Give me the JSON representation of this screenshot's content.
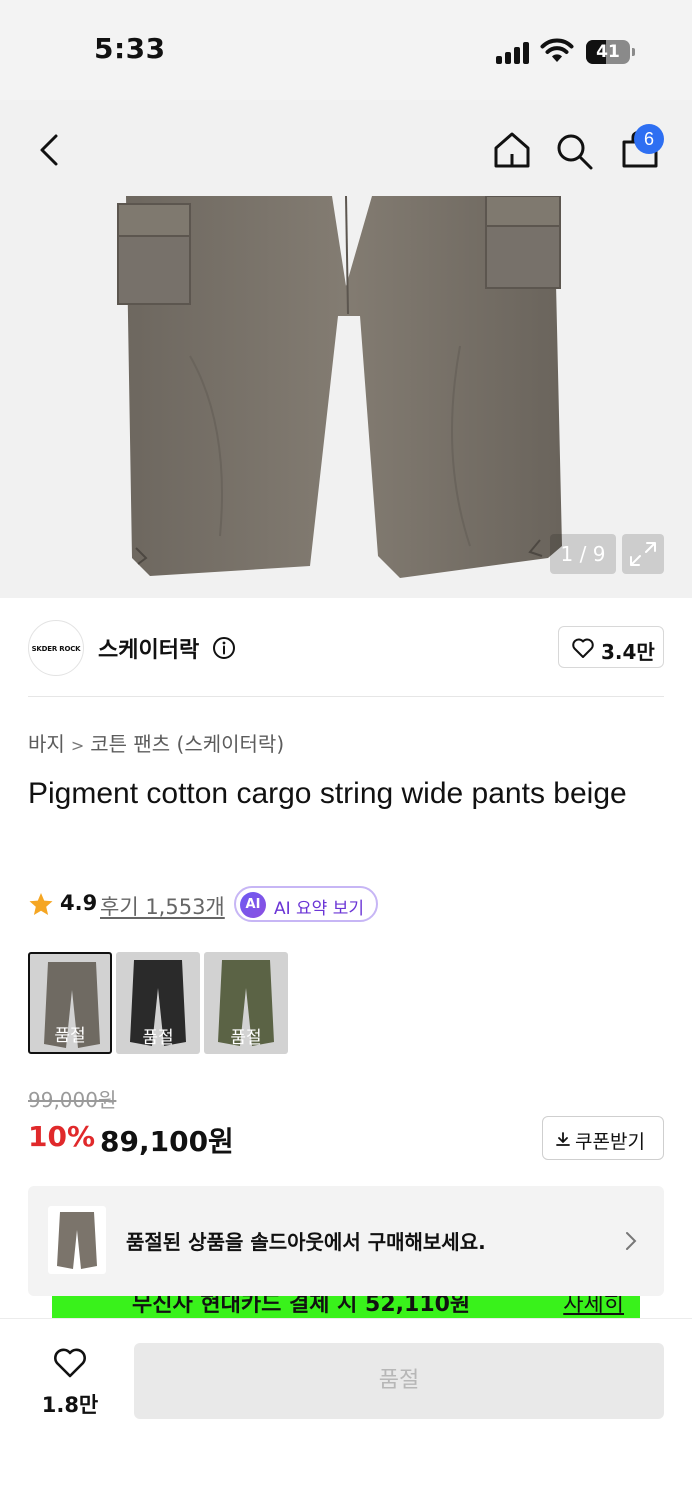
{
  "status_bar": {
    "time": "5:33",
    "battery": "41"
  },
  "nav": {
    "cart_count": "6"
  },
  "gallery": {
    "counter": "1 / 9"
  },
  "brand": {
    "logo_text": "SKDER ROCK",
    "name": "스케이터락",
    "likes": "3.4만"
  },
  "breadcrumb": {
    "category": "바지",
    "subcategory": "코튼 팬츠 (스케이터락)"
  },
  "product": {
    "title": "Pigment cotton cargo string wide pants beige",
    "rating": "4.9",
    "reviews": "후기 1,553개",
    "ai_badge": "AI",
    "ai_label": "AI 요약 보기"
  },
  "swatches": [
    {
      "label": "품절",
      "color": "#6f6a62"
    },
    {
      "label": "품절",
      "color": "#2a2a2a"
    },
    {
      "label": "품절",
      "color": "#5b6345"
    }
  ],
  "price": {
    "original": "99,000원",
    "discount": "10%",
    "final": "89,100원",
    "coupon_label": "쿠폰받기"
  },
  "soldout_banner": {
    "text": "품절된 상품을 솔드아웃에서 구매해보세요."
  },
  "promo": {
    "text": "무신사 현대카드 결제 시 52,110원",
    "link": "자세히"
  },
  "bottom": {
    "wish_count": "1.8만",
    "buy_label": "품절"
  },
  "colors": {
    "accent": "#2e6ff2",
    "discount": "#e0292b",
    "star": "#f5a623",
    "promo": "#39f21b"
  }
}
